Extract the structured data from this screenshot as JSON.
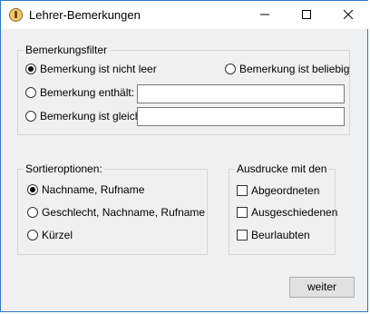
{
  "window": {
    "title": "Lehrer-Bemerkungen"
  },
  "filter": {
    "legend": "Bemerkungsfilter",
    "options": {
      "not_empty": "Bemerkung ist nicht leer",
      "any": "Bemerkung ist beliebig",
      "contains": "Bemerkung enthält:",
      "equals": "Bemerkung ist gleich:"
    },
    "selected": "not_empty",
    "contains_value": "",
    "equals_value": ""
  },
  "sort": {
    "legend": "Sortieroptionen:",
    "options": [
      {
        "label": "Nachname, Rufname",
        "checked": true
      },
      {
        "label": "Geschlecht, Nachname, Rufname",
        "checked": false
      },
      {
        "label": "Kürzel",
        "checked": false
      }
    ]
  },
  "print": {
    "legend": "Ausdrucke mit den",
    "options": [
      {
        "label": "Abgeordneten",
        "checked": false
      },
      {
        "label": "Ausgeschiedenen",
        "checked": false
      },
      {
        "label": "Beurlaubten",
        "checked": false
      }
    ]
  },
  "buttons": {
    "next": "weiter"
  },
  "icons": {
    "app": "app-icon",
    "minimize": "minimize-icon",
    "maximize": "maximize-icon",
    "close": "close-icon"
  }
}
